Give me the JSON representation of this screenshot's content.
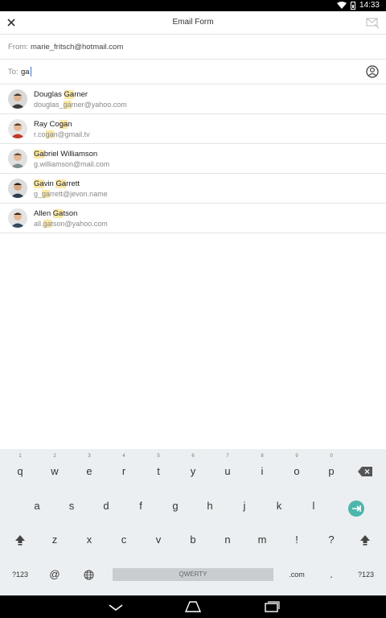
{
  "statusbar": {
    "time": "14:33"
  },
  "header": {
    "title": "Email Form"
  },
  "from": {
    "label": "From:",
    "value": "marie_fritsch@hotmail.com"
  },
  "to": {
    "label": "To:",
    "value": "ga"
  },
  "contacts": [
    {
      "name_pre": "Douglas ",
      "name_hl": "Ga",
      "name_post": "rner",
      "email_pre": "douglas_",
      "email_hl": "ga",
      "email_post": "rner@yahoo.com",
      "avatar_color": "#3a3a3a"
    },
    {
      "name_pre": "Ray Co",
      "name_hl": "ga",
      "name_post": "n",
      "email_pre": "r.co",
      "email_hl": "ga",
      "email_post": "n@gmail.tv",
      "avatar_color": "#c0392b"
    },
    {
      "name_pre": "",
      "name_hl": "Ga",
      "name_post": "briel Williamson",
      "email_pre": "",
      "email_hl": "g.",
      "email_post": "williamson@mail.com",
      "avatar_color": "#7f8c8d"
    },
    {
      "name_pre": "",
      "name_hl": "Ga",
      "name_post": "vin Garrett",
      "email_pre": "g_",
      "email_hl": "ga",
      "email_post": "rrett@jevon.name",
      "avatar_color": "#2c3e50"
    },
    {
      "name_pre": "Allen ",
      "name_hl": "Ga",
      "name_post": "tson",
      "email_pre": "all.",
      "email_hl": "ga",
      "email_post": "tson@yahoo.com",
      "avatar_color": "#34495e"
    }
  ],
  "keyboard": {
    "row1": [
      {
        "k": "q",
        "h": "1"
      },
      {
        "k": "w",
        "h": "2"
      },
      {
        "k": "e",
        "h": "3"
      },
      {
        "k": "r",
        "h": "4"
      },
      {
        "k": "t",
        "h": "5"
      },
      {
        "k": "y",
        "h": "6"
      },
      {
        "k": "u",
        "h": "7"
      },
      {
        "k": "i",
        "h": "8"
      },
      {
        "k": "o",
        "h": "9"
      },
      {
        "k": "p",
        "h": "0"
      }
    ],
    "row2": [
      "a",
      "s",
      "d",
      "f",
      "g",
      "h",
      "j",
      "k",
      "l"
    ],
    "row3": [
      "z",
      "x",
      "c",
      "v",
      "b",
      "n",
      "m",
      "!",
      "?"
    ],
    "bottom": {
      "sym": "?123",
      "at": "@",
      "space": "QWERTY",
      "dotcom": ".com",
      "dot": ".",
      "sym2": "?123"
    }
  }
}
